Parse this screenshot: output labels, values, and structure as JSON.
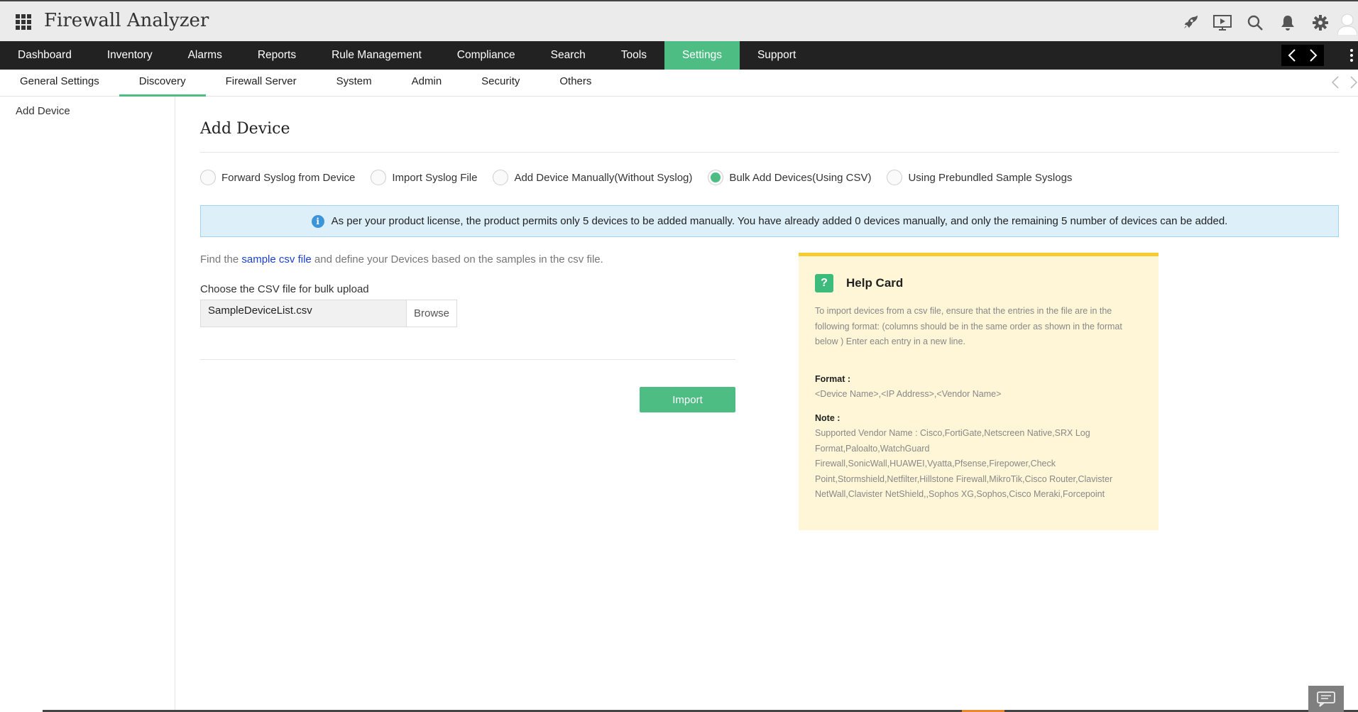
{
  "app": {
    "title": "Firewall Analyzer"
  },
  "top_icons": [
    "rocket-icon",
    "presentation-icon",
    "search-icon",
    "bell-icon",
    "gear-icon",
    "user-avatar-icon"
  ],
  "main_nav": {
    "items": [
      {
        "label": "Dashboard",
        "active": false
      },
      {
        "label": "Inventory",
        "active": false
      },
      {
        "label": "Alarms",
        "active": false
      },
      {
        "label": "Reports",
        "active": false
      },
      {
        "label": "Rule Management",
        "active": false
      },
      {
        "label": "Compliance",
        "active": false
      },
      {
        "label": "Search",
        "active": false
      },
      {
        "label": "Tools",
        "active": false
      },
      {
        "label": "Settings",
        "active": true
      },
      {
        "label": "Support",
        "active": false
      }
    ]
  },
  "sub_nav": {
    "items": [
      {
        "label": "General Settings",
        "active": false
      },
      {
        "label": "Discovery",
        "active": true
      },
      {
        "label": "Firewall Server",
        "active": false
      },
      {
        "label": "System",
        "active": false
      },
      {
        "label": "Admin",
        "active": false
      },
      {
        "label": "Security",
        "active": false
      },
      {
        "label": "Others",
        "active": false
      }
    ]
  },
  "sidebar": {
    "items": [
      {
        "label": "Add Device"
      }
    ]
  },
  "page": {
    "title": "Add Device",
    "radios": [
      {
        "label": "Forward Syslog from Device",
        "checked": false
      },
      {
        "label": "Import Syslog File",
        "checked": false
      },
      {
        "label": "Add Device Manually(Without Syslog)",
        "checked": false
      },
      {
        "label": "Bulk Add Devices(Using CSV)",
        "checked": true
      },
      {
        "label": "Using Prebundled Sample Syslogs",
        "checked": false
      }
    ],
    "info_banner": "As per your product license, the product permits only 5 devices to be added manually. You have already added 0 devices manually, and only the remaining 5 number of devices can be added.",
    "find_prefix": "Find the",
    "find_link": "sample csv file",
    "find_suffix": "and define your Devices based on the samples in the csv file.",
    "choose_label": "Choose the CSV file for bulk upload",
    "file_value": "SampleDeviceList.csv",
    "browse_label": "Browse",
    "import_label": "Import"
  },
  "help_card": {
    "title": "Help Card",
    "intro": "To import devices from a csv file, ensure that the entries in the file are in the following format: (columns should be in the same order as shown in the format below ) Enter each entry in a new line.",
    "format_label": "Format :",
    "format_value": "<Device Name>,<IP Address>,<Vendor Name>",
    "note_label": "Note :",
    "note_value": "Supported Vendor Name : Cisco,FortiGate,Netscreen Native,SRX Log Format,Paloalto,WatchGuard Firewall,SonicWall,HUAWEI,Vyatta,Pfsense,Firepower,Check Point,Stormshield,Netfilter,Hillstone Firewall,MikroTik,Cisco Router,Clavister NetWall,Clavister NetShield,,Sophos XG,Sophos,Cisco Meraki,Forcepoint"
  },
  "colors": {
    "accent": "#4dbd84",
    "nav_bg": "#222222",
    "info_bg": "#ddf0fa",
    "help_bg": "#fef6d6",
    "help_border": "#f6cd2a",
    "link": "#1a3fcf"
  }
}
